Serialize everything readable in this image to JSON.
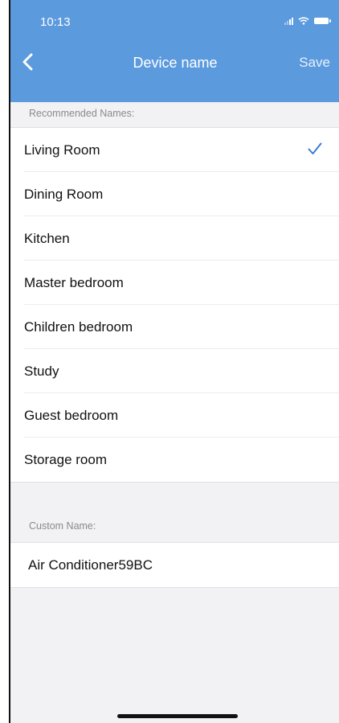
{
  "status_bar": {
    "time": "10:13"
  },
  "nav": {
    "title": "Device name",
    "save_label": "Save"
  },
  "recommended": {
    "header": "Recommended Names:",
    "items": [
      {
        "label": "Living Room",
        "selected": true
      },
      {
        "label": "Dining Room",
        "selected": false
      },
      {
        "label": "Kitchen",
        "selected": false
      },
      {
        "label": "Master bedroom",
        "selected": false
      },
      {
        "label": "Children bedroom",
        "selected": false
      },
      {
        "label": "Study",
        "selected": false
      },
      {
        "label": "Guest bedroom",
        "selected": false
      },
      {
        "label": "Storage room",
        "selected": false
      }
    ]
  },
  "custom": {
    "header": "Custom Name:",
    "value": "Air Conditioner59BC"
  },
  "colors": {
    "accent": "#5c9ade",
    "check": "#3a7bd5"
  }
}
